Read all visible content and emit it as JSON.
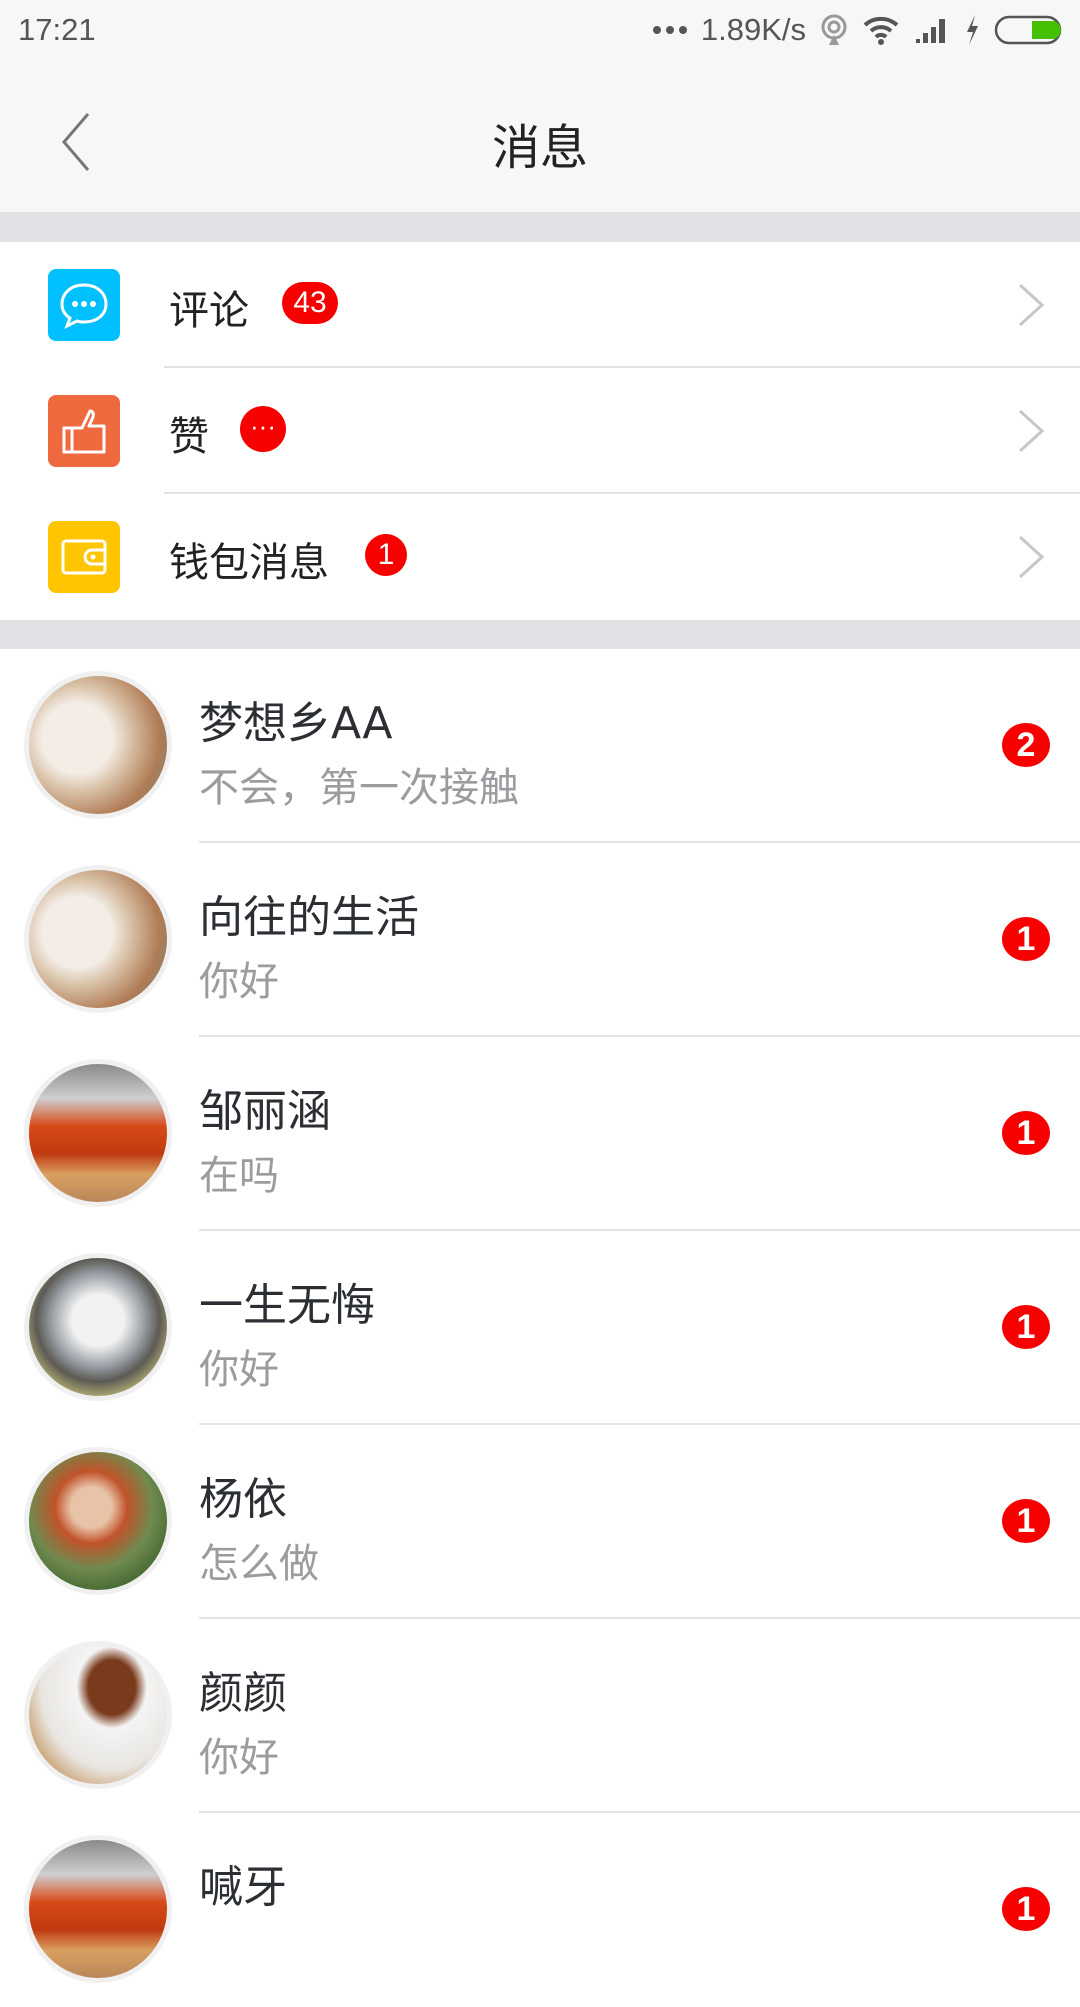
{
  "status_bar": {
    "time": "17:21",
    "network_speed": "1.89K/s",
    "icons": [
      "more-dots-icon",
      "hotspot-icon",
      "wifi-icon",
      "signal-icon",
      "charging-icon",
      "battery-icon"
    ],
    "battery_color": "#44c000"
  },
  "header": {
    "title": "消息",
    "back_icon": "chevron-left-icon"
  },
  "menu": [
    {
      "label": "评论",
      "badge": "43",
      "icon": "comment-bubble-icon",
      "color": "#00c0ff"
    },
    {
      "label": "赞",
      "badge": "···",
      "icon": "thumbs-up-icon",
      "color": "#ee6a3e"
    },
    {
      "label": "钱包消息",
      "badge": "1",
      "icon": "wallet-icon",
      "color": "#ffc600"
    }
  ],
  "conversations": [
    {
      "name": "梦想乡AA",
      "preview": "不会，第一次接触",
      "unread": "2",
      "avatar": "dog-photo"
    },
    {
      "name": "向往的生活",
      "preview": "你好",
      "unread": "1",
      "avatar": "dog-photo"
    },
    {
      "name": "邹丽涵",
      "preview": "在吗",
      "unread": "1",
      "avatar": "tomato-bread-photo"
    },
    {
      "name": "一生无悔",
      "preview": "你好",
      "unread": "1",
      "avatar": "kitten-photo"
    },
    {
      "name": "杨依",
      "preview": "怎么做",
      "unread": "1",
      "avatar": "hooded-woman-illustration"
    },
    {
      "name": "颜颜",
      "preview": "你好",
      "unread": "",
      "avatar": "tea-cup-photo"
    },
    {
      "name": "喊牙",
      "preview": "",
      "unread": "1",
      "avatar": "tomato-bread-photo"
    }
  ],
  "colors": {
    "badge": "#f60000",
    "separator_band": "#e1e2e6"
  }
}
